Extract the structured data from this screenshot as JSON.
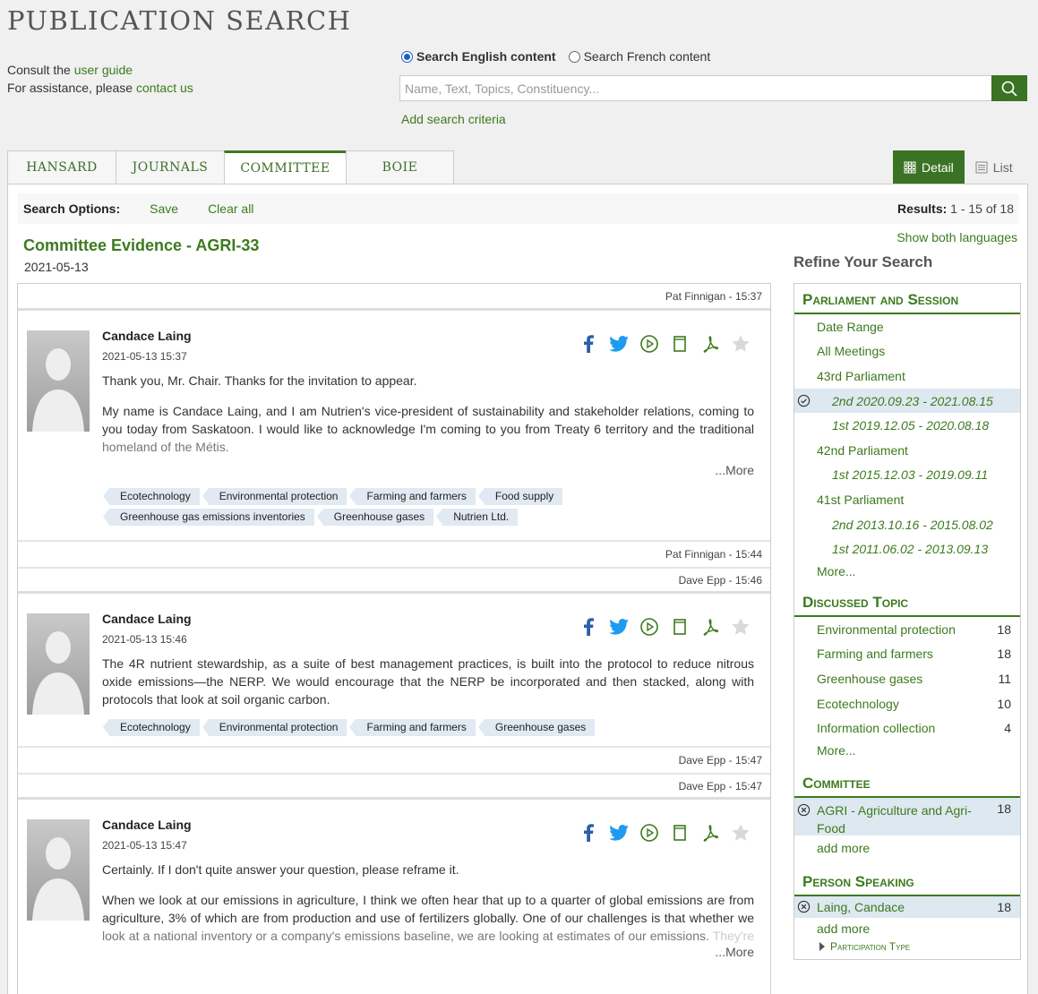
{
  "header": {
    "title": "PUBLICATION SEARCH",
    "help_line1_prefix": "Consult the ",
    "help_line1_link": "user guide",
    "help_line2_prefix": "For assistance, please ",
    "help_line2_link": "contact us"
  },
  "search": {
    "radio_english": "Search English content",
    "radio_french": "Search French content",
    "selected": "english",
    "placeholder": "Name, Text, Topics, Constituency...",
    "add_criteria": "Add search criteria"
  },
  "tabs": [
    {
      "label": "HANSARD",
      "active": false
    },
    {
      "label": "JOURNALS",
      "active": false
    },
    {
      "label": "COMMITTEE",
      "active": true
    },
    {
      "label": "BOIE",
      "active": false
    }
  ],
  "view": {
    "detail": "Detail",
    "list": "List"
  },
  "options": {
    "label": "Search Options:",
    "save": "Save",
    "clear": "Clear all",
    "results_label": "Results:",
    "results_value": "1 - 15 of 18"
  },
  "evidence": {
    "title": "Committee Evidence - AGRI-33",
    "date": "2021-05-13",
    "show_both": "Show both languages"
  },
  "feed": {
    "ts1": "Pat Finnigan - 15:37",
    "card1": {
      "speaker": "Candace Laing",
      "time": "2021-05-13 15:37",
      "p1": "Thank you, Mr. Chair. Thanks for the invitation to appear.",
      "p2a": "My name is Candace Laing, and I am Nutrien's vice-president of sustainability and stakeholder relations, coming to you today from Saskatoon. I would like to acknowledge I'm coming to you from Treaty 6 territory and the traditional",
      "p2b": "homeland of the Métis.",
      "more": "...More",
      "tags": [
        "Ecotechnology",
        "Environmental protection",
        "Farming and farmers",
        "Food supply",
        "Greenhouse gas emissions inventories",
        "Greenhouse gases",
        "Nutrien Ltd."
      ]
    },
    "ts2": "Pat Finnigan - 15:44",
    "ts3": "Dave Epp - 15:46",
    "card2": {
      "speaker": "Candace Laing",
      "time": "2021-05-13 15:46",
      "p1": "The 4R nutrient stewardship, as a suite of best management practices, is built into the protocol to reduce nitrous oxide emissions—the NERP. We would encourage that the NERP be incorporated and then stacked, along with protocols that look at soil organic carbon.",
      "tags": [
        "Ecotechnology",
        "Environmental protection",
        "Farming and farmers",
        "Greenhouse gases"
      ]
    },
    "ts4": "Dave Epp - 15:47",
    "ts5": "Dave Epp - 15:47",
    "card3": {
      "speaker": "Candace Laing",
      "time": "2021-05-13 15:47",
      "p1": "Certainly. If I don't quite answer your question, please reframe it.",
      "p2a": "When we look at our emissions in agriculture, I think we often hear that up to a quarter of global emissions are from agriculture, 3% of which are from production and use of fertilizers globally. One of our challenges is that whether we",
      "p2b": "look at a national inventory or a company's emissions baseline, we are looking at estimates of our emissions.",
      "p2c": "They're not measured directly but are estimated based on global emissions factors, and they don't necessarily",
      "more": "...More"
    }
  },
  "refine": {
    "heading": "Refine Your Search",
    "parliament": {
      "title": "Parliament and Session",
      "items": [
        {
          "label": "Date Range"
        },
        {
          "label": "All Meetings"
        },
        {
          "label": "43rd Parliament"
        },
        {
          "label": "2nd 2020.09.23 - 2021.08.15",
          "sub": true,
          "selected": true
        },
        {
          "label": "1st 2019.12.05 - 2020.08.18",
          "sub": true
        },
        {
          "label": "42nd Parliament"
        },
        {
          "label": "1st 2015.12.03 - 2019.09.11",
          "sub": true
        },
        {
          "label": "41st Parliament"
        },
        {
          "label": "2nd 2013.10.16 - 2015.08.02",
          "sub": true
        },
        {
          "label": "1st 2011.06.02 - 2013.09.13",
          "sub": true
        }
      ],
      "more": "More..."
    },
    "topic": {
      "title": "Discussed Topic",
      "items": [
        {
          "label": "Environmental protection",
          "count": "18"
        },
        {
          "label": "Farming and farmers",
          "count": "18"
        },
        {
          "label": "Greenhouse gases",
          "count": "11"
        },
        {
          "label": "Ecotechnology",
          "count": "10"
        },
        {
          "label": "Information collection",
          "count": "4"
        }
      ],
      "more": "More..."
    },
    "committee": {
      "title": "Committee",
      "item": {
        "label": "AGRI - Agriculture and Agri-Food",
        "count": "18"
      },
      "add": "add more"
    },
    "person": {
      "title": "Person Speaking",
      "item": {
        "label": "Laing, Candace",
        "count": "18"
      },
      "add": "add more",
      "participation": "Participation Type"
    }
  },
  "colors": {
    "accent": "#3d7a1e",
    "button": "#3a7323",
    "tag": "#e1e9f2",
    "selected_row": "#dde8f0"
  }
}
